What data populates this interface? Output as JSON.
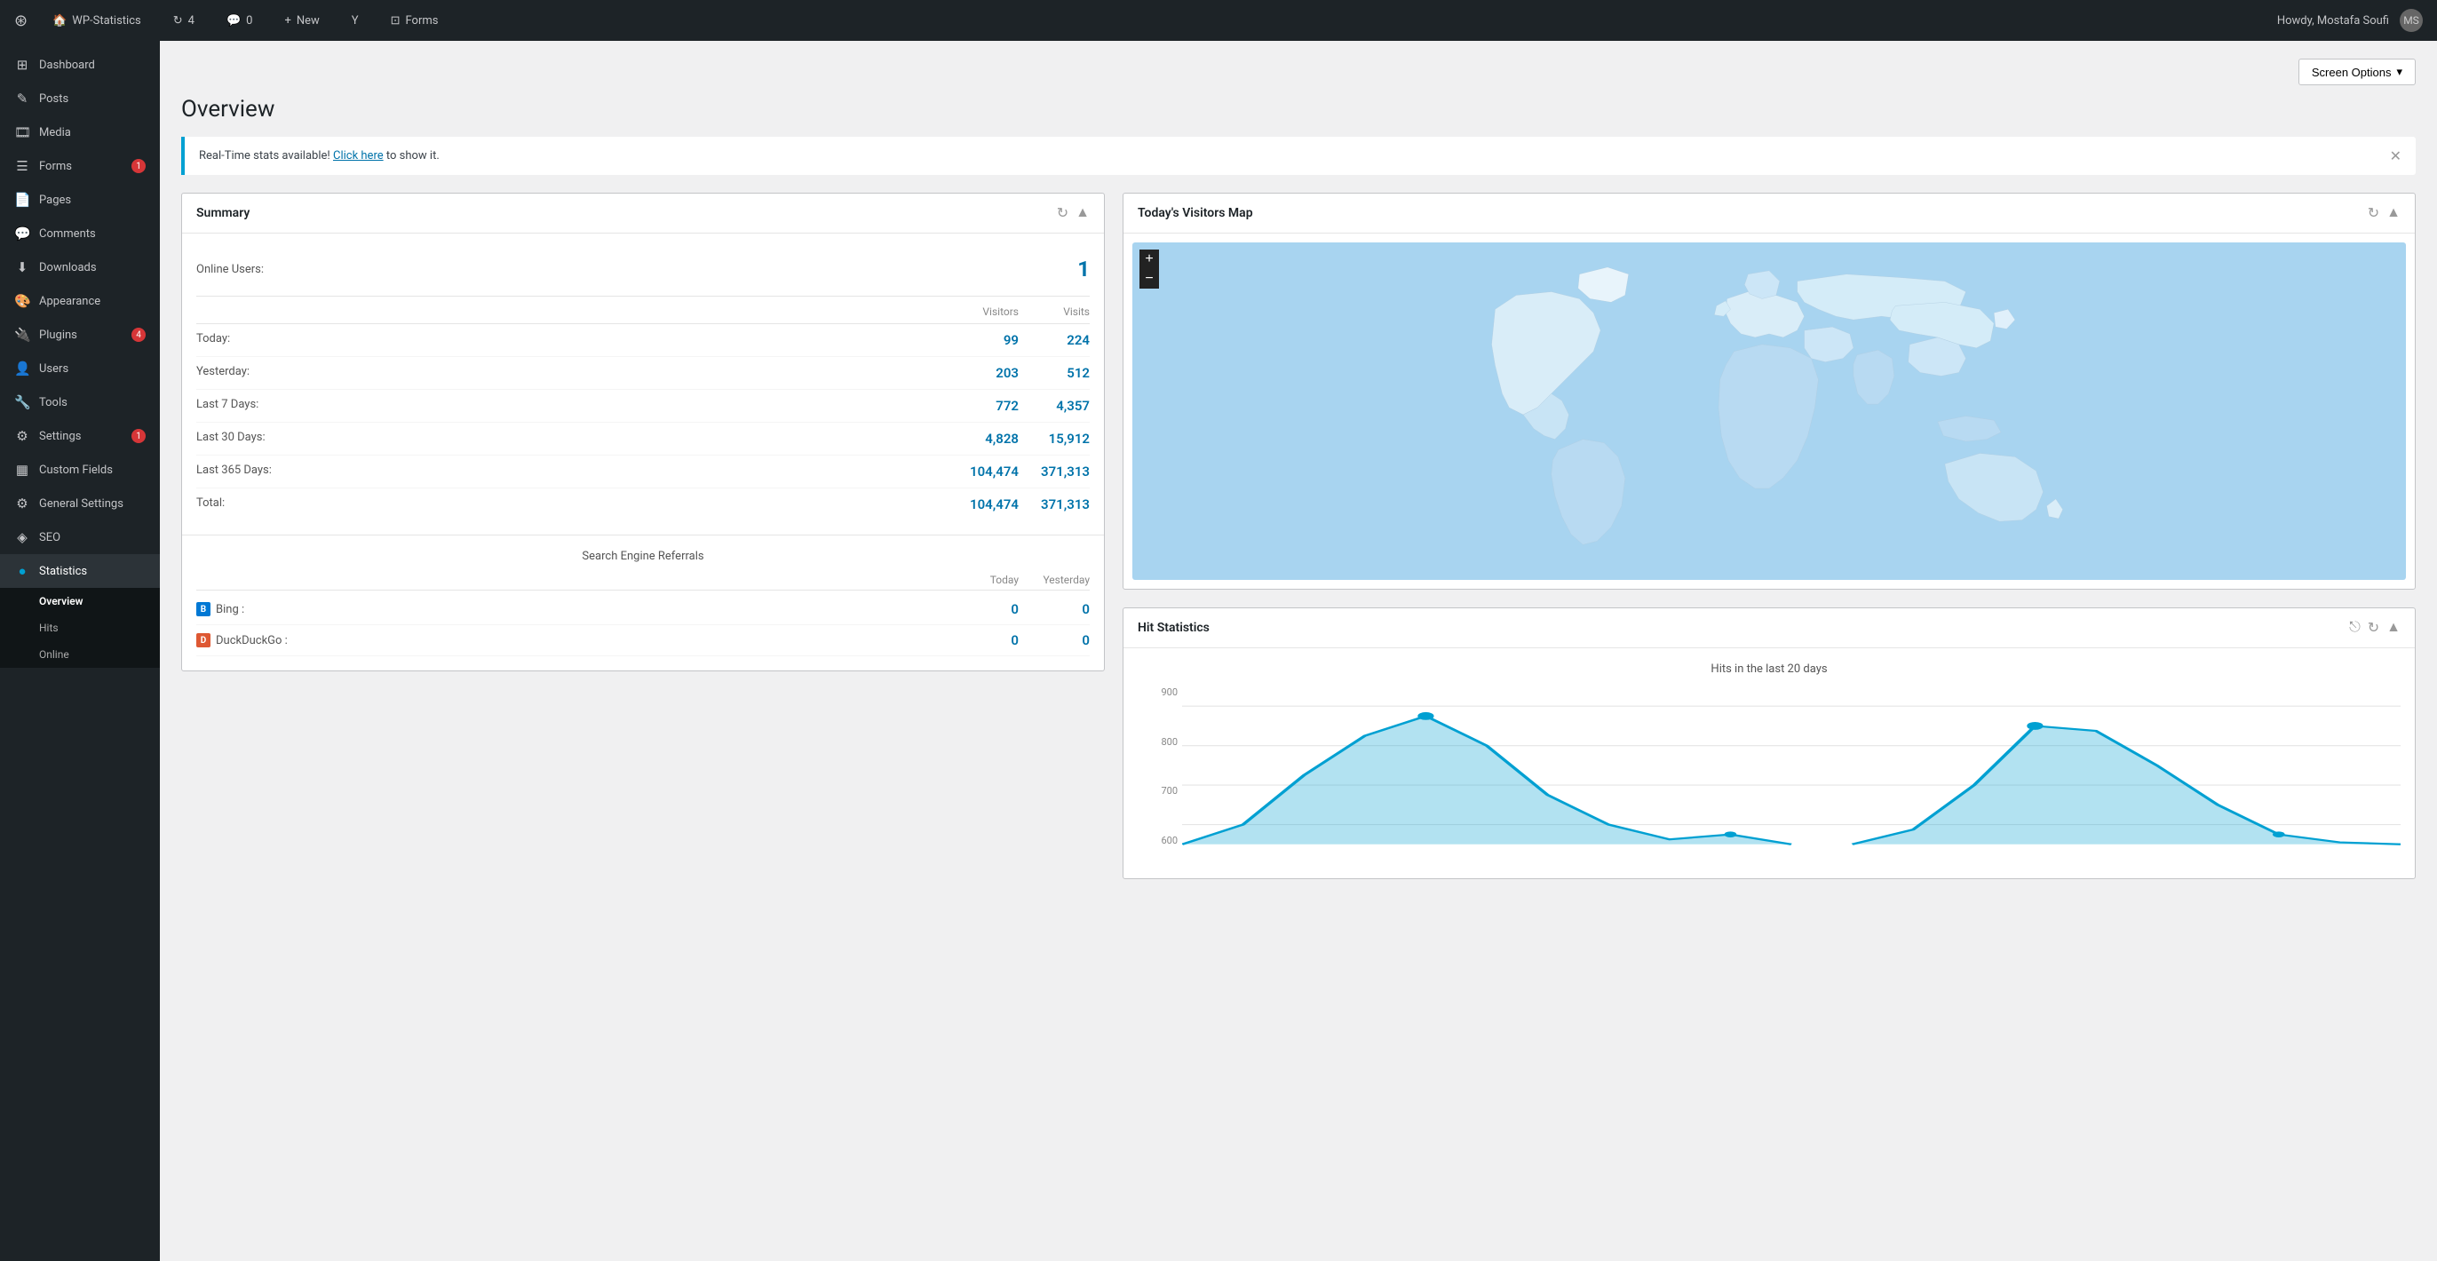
{
  "adminbar": {
    "logo": "⊞",
    "site_name": "WP-Statistics",
    "updates_count": "4",
    "comments_count": "0",
    "new_label": "New",
    "forms_label": "Forms",
    "howdy": "Howdy, Mostafa Soufi",
    "screen_options_label": "Screen Options"
  },
  "sidebar": {
    "items": [
      {
        "id": "dashboard",
        "label": "Dashboard",
        "icon": "⊞"
      },
      {
        "id": "posts",
        "label": "Posts",
        "icon": "✎"
      },
      {
        "id": "media",
        "label": "Media",
        "icon": "🎞"
      },
      {
        "id": "forms",
        "label": "Forms",
        "icon": "☰",
        "badge": "1"
      },
      {
        "id": "pages",
        "label": "Pages",
        "icon": "📄"
      },
      {
        "id": "comments",
        "label": "Comments",
        "icon": "💬"
      },
      {
        "id": "downloads",
        "label": "Downloads",
        "icon": "⬇"
      },
      {
        "id": "appearance",
        "label": "Appearance",
        "icon": "🎨"
      },
      {
        "id": "plugins",
        "label": "Plugins",
        "icon": "🔌",
        "badge": "4"
      },
      {
        "id": "users",
        "label": "Users",
        "icon": "👤"
      },
      {
        "id": "tools",
        "label": "Tools",
        "icon": "🔧"
      },
      {
        "id": "settings",
        "label": "Settings",
        "icon": "⚙",
        "badge": "1"
      },
      {
        "id": "custom-fields",
        "label": "Custom Fields",
        "icon": "▦"
      },
      {
        "id": "general-settings",
        "label": "General Settings",
        "icon": "⚙"
      },
      {
        "id": "seo",
        "label": "SEO",
        "icon": "◈"
      },
      {
        "id": "statistics",
        "label": "Statistics",
        "icon": "●",
        "active": true
      }
    ],
    "submenu": [
      {
        "id": "overview",
        "label": "Overview",
        "active": true
      },
      {
        "id": "hits",
        "label": "Hits"
      },
      {
        "id": "online",
        "label": "Online"
      }
    ]
  },
  "page": {
    "title": "Overview"
  },
  "notice": {
    "text": "Real-Time stats available!",
    "link_text": "Click here",
    "text_after": "to show it."
  },
  "summary_widget": {
    "title": "Summary",
    "online_label": "Online Users:",
    "online_value": "1",
    "col_visitors": "Visitors",
    "col_visits": "Visits",
    "rows": [
      {
        "label": "Today:",
        "visitors": "99",
        "visits": "224"
      },
      {
        "label": "Yesterday:",
        "visitors": "203",
        "visits": "512"
      },
      {
        "label": "Last 7 Days:",
        "visitors": "772",
        "visits": "4,357"
      },
      {
        "label": "Last 30 Days:",
        "visitors": "4,828",
        "visits": "15,912"
      },
      {
        "label": "Last 365 Days:",
        "visitors": "104,474",
        "visits": "371,313"
      },
      {
        "label": "Total:",
        "visitors": "104,474",
        "visits": "371,313"
      }
    ]
  },
  "referrals_widget": {
    "title": "Search Engine Referrals",
    "col_today": "Today",
    "col_yesterday": "Yesterday",
    "engines": [
      {
        "name": "Bing",
        "icon_type": "bing",
        "today": "0",
        "yesterday": "0"
      },
      {
        "name": "DuckDuckGo",
        "icon_type": "ddg",
        "today": "0",
        "yesterday": "0"
      }
    ]
  },
  "map_widget": {
    "title": "Today's Visitors Map",
    "zoom_plus": "+",
    "zoom_minus": "−"
  },
  "hit_stats_widget": {
    "title": "Hit Statistics",
    "chart_title": "Hits in the last 20 days",
    "y_labels": [
      "900",
      "800",
      "700",
      "600"
    ],
    "colors": {
      "line": "#00a0d2",
      "fill": "rgba(0,160,210,0.3)",
      "point": "#00a0d2"
    }
  }
}
